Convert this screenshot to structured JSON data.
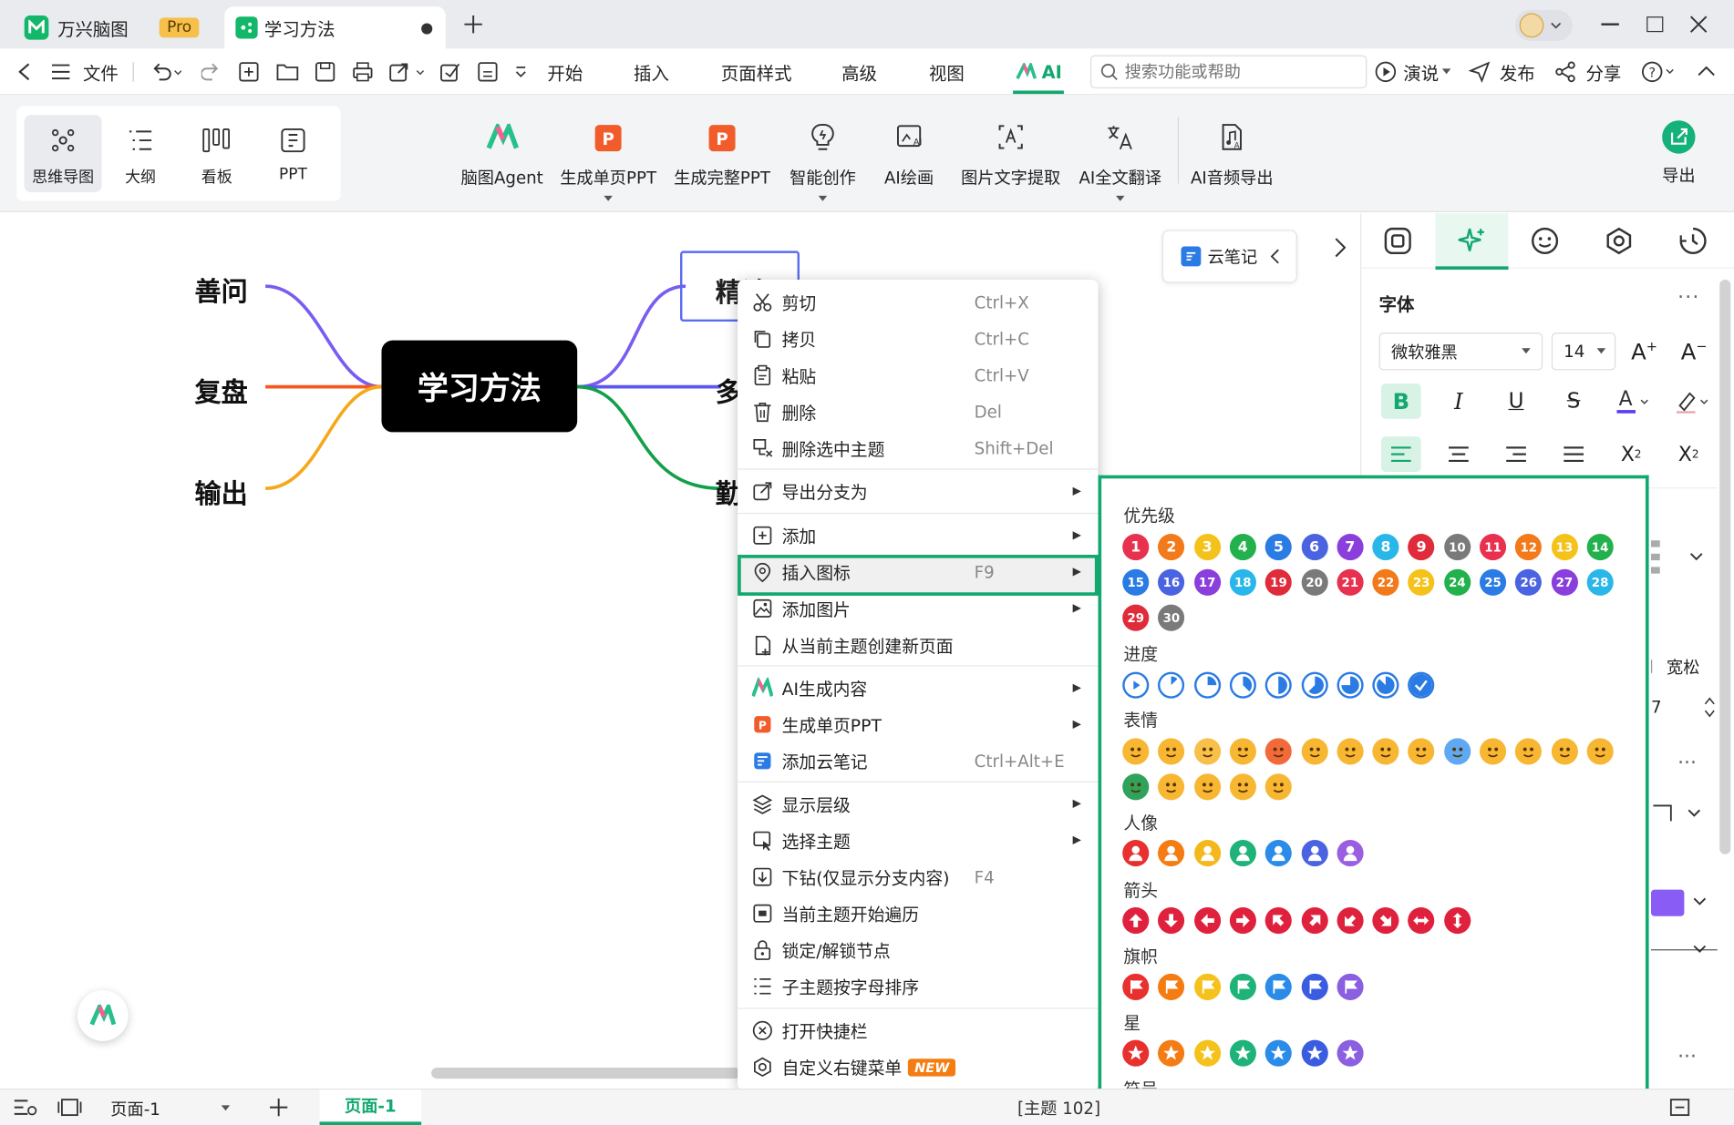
{
  "tabs": {
    "app_name": "万兴脑图",
    "pro_badge": "Pro",
    "doc_name": "学习方法"
  },
  "menubar": {
    "file": "文件",
    "items": [
      "开始",
      "插入",
      "页面样式",
      "高级",
      "视图",
      "AI"
    ],
    "search_placeholder": "搜索功能或帮助",
    "present": "演说",
    "publish": "发布",
    "share": "分享"
  },
  "ribbon": {
    "views": [
      "思维导图",
      "大纲",
      "看板",
      "PPT"
    ],
    "ai_tools": [
      "脑图Agent",
      "生成单页PPT",
      "生成完整PPT",
      "智能创作",
      "AI绘画",
      "图片文字提取",
      "AI全文翻译",
      "AI音频导出"
    ],
    "export": "导出"
  },
  "mindmap": {
    "central": "学习方法",
    "left": [
      "善问",
      "复盘",
      "输出"
    ],
    "right": [
      "精读",
      "多",
      "勤"
    ]
  },
  "cloud_note": "云笔记",
  "context_menu": [
    {
      "label": "剪切",
      "shortcut": "Ctrl+X",
      "icon": "scissors-icon"
    },
    {
      "label": "拷贝",
      "shortcut": "Ctrl+C",
      "icon": "copy-icon"
    },
    {
      "label": "粘贴",
      "shortcut": "Ctrl+V",
      "icon": "paste-icon"
    },
    {
      "label": "删除",
      "shortcut": "Del",
      "icon": "trash-icon"
    },
    {
      "label": "删除选中主题",
      "shortcut": "Shift+Del",
      "icon": "delete-topic-icon"
    },
    {
      "label": "导出分支为",
      "shortcut": "",
      "icon": "export-icon",
      "submenu": true
    },
    {
      "label": "添加",
      "shortcut": "",
      "icon": "add-icon",
      "submenu": true
    },
    {
      "label": "插入图标",
      "shortcut": "F9",
      "icon": "insert-icon-icon",
      "submenu": true
    },
    {
      "label": "添加图片",
      "shortcut": "",
      "icon": "image-icon",
      "submenu": true
    },
    {
      "label": "从当前主题创建新页面",
      "shortcut": "",
      "icon": "new-page-icon"
    },
    {
      "label": "AI生成内容",
      "shortcut": "",
      "icon": "ai-icon",
      "submenu": true
    },
    {
      "label": "生成单页PPT",
      "shortcut": "",
      "icon": "ppt-icon",
      "submenu": true
    },
    {
      "label": "添加云笔记",
      "shortcut": "Ctrl+Alt+E",
      "icon": "cloud-note-icon"
    },
    {
      "label": "显示层级",
      "shortcut": "",
      "icon": "layers-icon",
      "submenu": true
    },
    {
      "label": "选择主题",
      "shortcut": "",
      "icon": "select-topic-icon",
      "submenu": true
    },
    {
      "label": "下钻(仅显示分支内容)",
      "shortcut": "F4",
      "icon": "drill-down-icon"
    },
    {
      "label": "当前主题开始遍历",
      "shortcut": "",
      "icon": "traverse-icon"
    },
    {
      "label": "锁定/解锁节点",
      "shortcut": "",
      "icon": "lock-icon"
    },
    {
      "label": "子主题按字母排序",
      "shortcut": "",
      "icon": "sort-icon"
    },
    {
      "label": "打开快捷栏",
      "shortcut": "",
      "icon": "close-circle-icon"
    },
    {
      "label": "自定义右键菜单",
      "shortcut": "",
      "icon": "settings-icon",
      "badge": "NEW"
    }
  ],
  "icon_panel": {
    "categories": [
      "优先级",
      "进度",
      "表情",
      "人像",
      "箭头",
      "旗帜",
      "星",
      "符号"
    ],
    "priority_numbers": [
      "1",
      "2",
      "3",
      "4",
      "5",
      "6",
      "7",
      "8",
      "9",
      "10",
      "11",
      "12",
      "13",
      "14",
      "15",
      "16",
      "17",
      "18",
      "19",
      "20",
      "21",
      "22",
      "23",
      "24",
      "25",
      "26",
      "27",
      "28",
      "29",
      "30"
    ],
    "priority_colors": [
      "#e8304f",
      "#f27a1a",
      "#f5c21b",
      "#23b14d",
      "#2a7be4",
      "#4a63e0",
      "#8a3fdc",
      "#29b6e8",
      "#e02b3a",
      "#7a7a7a"
    ],
    "person_colors": [
      "#e8302f",
      "#f57c12",
      "#f5b81b",
      "#1fb37a",
      "#2a8be8",
      "#4a63e0",
      "#9a5fe0"
    ],
    "flag_colors": [
      "#e8302f",
      "#f57c12",
      "#f5c21b",
      "#1fb37a",
      "#2a8be8",
      "#3a5ce0",
      "#8a5fe0"
    ]
  },
  "right_panel": {
    "section_font": "字体",
    "font_name": "微软雅黑",
    "font_size": "14",
    "spacing_label": "宽松"
  },
  "statusbar": {
    "page_select": "页面-1",
    "page_tab": "页面-1",
    "topic_count": "[主题 102]"
  },
  "colors": {
    "accent": "#12a86f",
    "central_bg": "#000000",
    "branch_purple": "#7b5cf0",
    "branch_orange": "#f5591f",
    "branch_yellow": "#f5a81a",
    "branch_blue": "#5b57f0",
    "branch_green": "#13a04a"
  }
}
